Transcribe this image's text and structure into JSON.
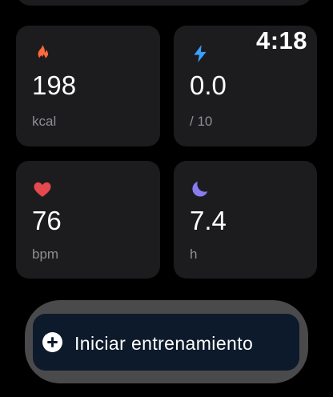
{
  "status": {
    "time": "4:18"
  },
  "metrics": [
    {
      "icon": "flame-icon",
      "value": "198",
      "unit": "kcal",
      "color": "#ff6a3d"
    },
    {
      "icon": "lightning-icon",
      "value": "0.0",
      "unit": "/ 10",
      "color": "#3aa0ff"
    },
    {
      "icon": "heart-icon",
      "value": "76",
      "unit": "bpm",
      "color": "#e5484d"
    },
    {
      "icon": "moon-icon",
      "value": "7.4",
      "unit": "h",
      "color": "#8a7cf0"
    }
  ],
  "workout": {
    "label": "Iniciar entrenamiento",
    "icon": "plus-circle-icon"
  },
  "colors": {
    "background": "#000000",
    "card": "#1c1c1e",
    "unit_text": "#8e8e93",
    "button_bg": "#0d1a2b",
    "button_ring": "#4a4a4c"
  }
}
